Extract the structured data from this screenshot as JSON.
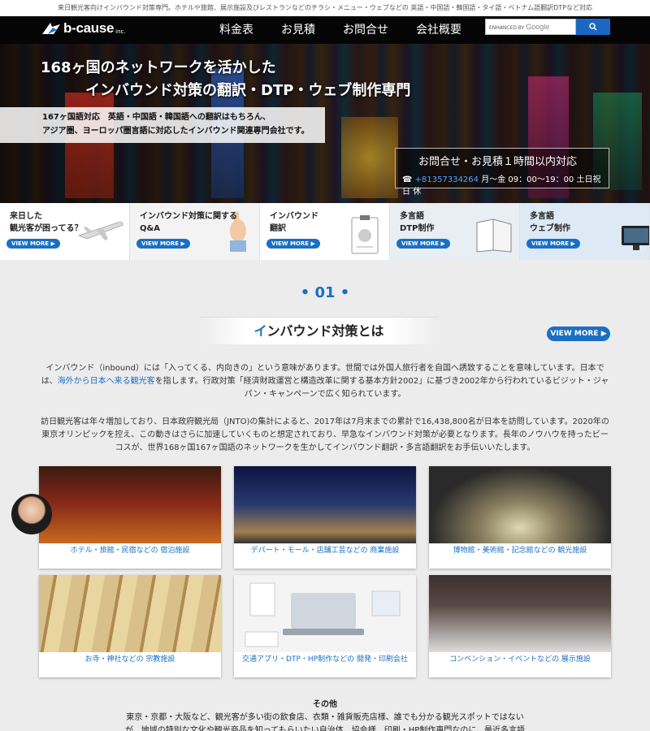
{
  "topline": "来日観光客向けインバウンド対策専門。ホテルや旅館、展示施設及びレストランなどのチラシ・メニュー・ウェブなどの 英語・中国語・韓国語・タイ語・ベトナム語翻訳DTPなど対応",
  "header": {
    "logo_text": "b-cause",
    "logo_suffix": "inc.",
    "nav": [
      "料金表",
      "お見積",
      "お問合せ",
      "会社概要"
    ],
    "search": {
      "label_small": "ENHANCED BY",
      "label_brand": "Google"
    }
  },
  "hero": {
    "title_line1": "168ヶ国のネットワークを活かした",
    "title_line2": "インバウンド対策の翻訳・DTP・ウェブ制作専門",
    "sub_line1": "167ヶ国語対応　英語・中国語・韓国語への翻訳はもちろん、",
    "sub_line2": "アジア圏、ヨーロッパ圏言語に対応したインバウンド関連専門会社です。",
    "contact_title": "お問合せ・お見積１時間以内対応",
    "phone": "+81357334264",
    "hours": "月〜金 09：00〜19：00 土日祝日 休"
  },
  "cards": [
    {
      "line1": "来日した",
      "line2": "観光客が困ってる？",
      "more": "VIEW MORE ▶"
    },
    {
      "line1": "インバウンド対策に関する",
      "line2": "Q&A",
      "more": "VIEW MORE ▶"
    },
    {
      "line1": "インバウンド",
      "line2": "翻訳",
      "more": "VIEW MORE ▶"
    },
    {
      "line1": "多言語",
      "line2": "DTP制作",
      "more": "VIEW MORE ▶"
    },
    {
      "line1": "多言語",
      "line2": "ウェブ制作",
      "more": "VIEW MORE ▶"
    }
  ],
  "section": {
    "number": "• 01 •",
    "title_first": "イ",
    "title_rest": "ンバウンド対策とは",
    "more": "VIEW MORE ▶",
    "p1_a": "インバウンド（inbound）には「入ってくる、内向きの」という意味があります。世間では外国人旅行者を自国へ誘致することを意味しています。日本では、",
    "p1_hl": "海外から日本へ来る観光客",
    "p1_b": "を指します。行政対策「経済財政運営と構造改革に関する基本方針2002」に基づき2002年から行われているビジット・ジャパン・キャンペーンで広く知られています。",
    "p2": "訪日観光客は年々増加しており、日本政府観光局（JNTO)の集計によると、2017年は7月末までの累計で16,438,800名が日本を訪問しています。2020年の東京オリンピックを控え、この動きはさらに加速していくものと想定されており、早急なインバウンド対策が必要となります。長年のノウハウを持ったビーコスが、世界168ヶ国167ヶ国語のネットワークを生かしてインバウンド翻訳・多言語翻訳をお手伝いいたします。"
  },
  "tiles": [
    "ホテル・旅館・民宿などの 宿泊施設",
    "デパート・モール・店舗工芸などの 商業施設",
    "博物館・美術館・記念館などの 観光施設",
    "お寺・神社などの 宗教施設",
    "交通アプリ・DTP・HP制作などの 開発・印刷会社",
    "コンベンション・イベントなどの 展示施設"
  ],
  "other": {
    "heading": "その他",
    "text": "東京・京都・大阪など、観光客が多い街の飲食店、衣類・雑貨販売店様、誰でも分かる観光スポットではないが、地域の特別な文化や観光商品を知ってもらいたい自治体、協会様、印刷・HP制作専門なのに、最近多言語化HPの制作が増えたと感じる業者様　など"
  }
}
